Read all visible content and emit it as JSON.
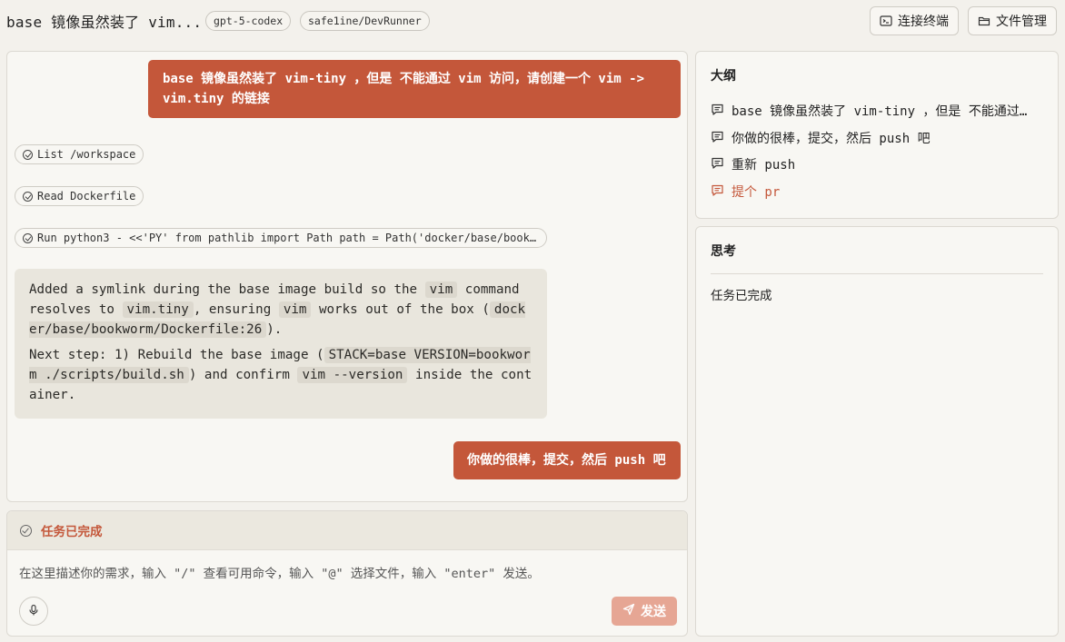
{
  "header": {
    "title": "base 镜像虽然装了 vim...",
    "model_pill": "gpt-5-codex",
    "repo_pill": "safe1ine/DevRunner",
    "terminal_button": "连接终端",
    "files_button": "文件管理"
  },
  "chat": {
    "messages": [
      {
        "role": "user",
        "text": "base 镜像虽然装了 vim-tiny ，但是 不能通过 vim 访问，请创建一个 vim -> vim.tiny 的链接"
      },
      {
        "role": "tool",
        "text": "List /workspace"
      },
      {
        "role": "tool",
        "text": "Read Dockerfile"
      },
      {
        "role": "tool",
        "text": "Run python3 - <<'PY' from pathlib import Path path = Path('docker/base/book…"
      },
      {
        "role": "assistant",
        "p1": {
          "t1": "Added a symlink during the base image build so the ",
          "c1": "vim",
          "t2": " command resolves to ",
          "c2": "vim.tiny",
          "t3": ", ensuring ",
          "c3": "vim",
          "t4": " works out of the box (",
          "c4": "docker/base/bookworm/Dockerfile:26",
          "t5": ")."
        },
        "p2": {
          "t1": "Next step: 1) Rebuild the base image (",
          "c1": "STACK=base VERSION=bookworm ./scripts/build.sh",
          "t2": ") and confirm ",
          "c2": "vim --version",
          "t3": " inside the container."
        }
      },
      {
        "role": "user",
        "text": "你做的很棒，提交，然后 push 吧"
      }
    ]
  },
  "status": {
    "text": "任务已完成"
  },
  "input": {
    "placeholder": "在这里描述你的需求，输入 \"/\" 查看可用命令，输入 \"@\" 选择文件，输入 \"enter\" 发送。",
    "send_label": "发送"
  },
  "outline": {
    "title": "大纲",
    "items": [
      {
        "label": "base 镜像虽然装了 vim-tiny ，但是 不能通过…"
      },
      {
        "label": "你做的很棒，提交，然后 push 吧"
      },
      {
        "label": "重新 push"
      },
      {
        "label": "提个 pr"
      }
    ]
  },
  "thinking": {
    "title": "思考",
    "text": "任务已完成"
  },
  "colors": {
    "accent": "#c4573a",
    "send_disabled": "#e6a694",
    "background": "#f3f1ec"
  }
}
